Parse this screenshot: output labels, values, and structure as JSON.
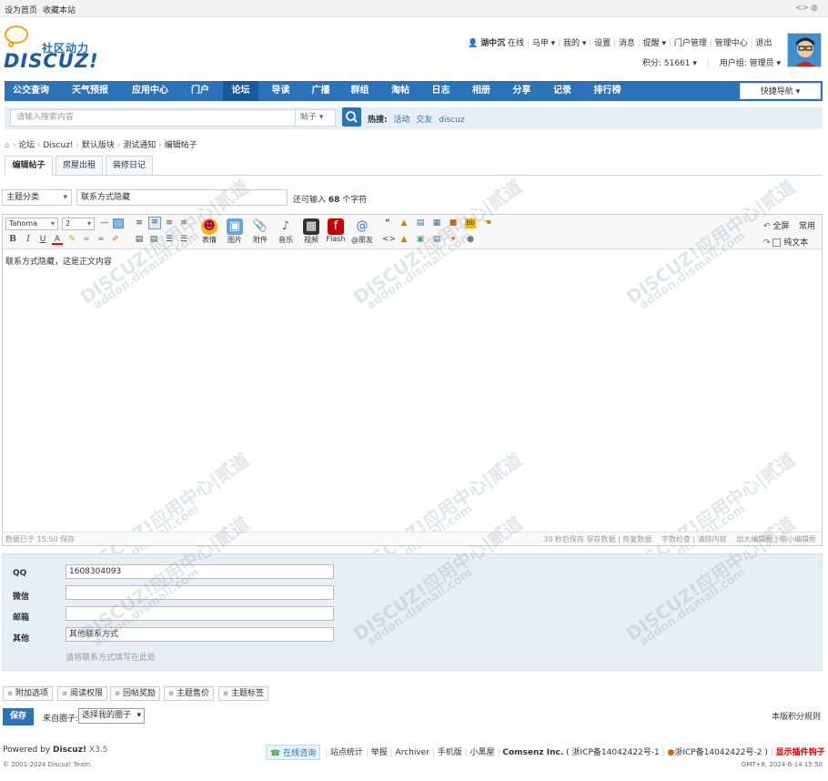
{
  "topbar": {
    "set_home": "设为首页",
    "bookmark": "收藏本站"
  },
  "logo": {
    "sub": "社区动力",
    "text": "DISCUZ!"
  },
  "user": {
    "name": "湖中沉",
    "status": "在线",
    "links": [
      "马甲 ▾",
      "我的 ▾",
      "设置",
      "消息",
      "提醒 ▾",
      "门户管理",
      "管理中心",
      "退出"
    ],
    "points": "积分: 51661 ▾",
    "group": "用户组: 管理员 ▾"
  },
  "nav": {
    "items": [
      "公交查询",
      "天气预报",
      "应用中心",
      "门户",
      "论坛",
      "导读",
      "广播",
      "群组",
      "淘帖",
      "日志",
      "相册",
      "分享",
      "记录",
      "排行榜"
    ],
    "quick": "快捷导航 ▾"
  },
  "search": {
    "placeholder": "请输入搜索内容",
    "type": "帖子 ▾",
    "hot_label": "热搜:",
    "hot": [
      "活动",
      "交友",
      "discuz"
    ]
  },
  "breadcrumb": [
    "论坛",
    "Discuz!",
    "默认版块",
    "测试通知",
    "编辑帖子"
  ],
  "tabs": [
    "编辑帖子",
    "房屋出租",
    "装修日记"
  ],
  "form": {
    "category": "主题分类",
    "title": "联系方式隐藏",
    "remain_prefix": "还可输入",
    "remain_count": "68",
    "remain_suffix": "个字符"
  },
  "editor": {
    "font": "Tahoma",
    "size": "2",
    "big_buttons": [
      "表情",
      "图片",
      "附件",
      "音乐",
      "视频",
      "Flash",
      "@朋友"
    ],
    "fullscreen": "全屏",
    "common": "常用",
    "plaintext": "纯文本",
    "content": "联系方式隐藏，这是正文内容",
    "saved": "数据已于 15:50 保存",
    "footer_right": [
      "30 秒后保存",
      "保存数据",
      "恢复数据",
      "字数检查",
      "清除内容",
      "加大编辑框",
      "缩小编辑框"
    ]
  },
  "contact": {
    "fields": [
      {
        "label": "QQ",
        "value": "1608304093"
      },
      {
        "label": "微信",
        "value": ""
      },
      {
        "label": "邮箱",
        "value": ""
      },
      {
        "label": "其他",
        "value": "其他联系方式"
      }
    ],
    "hint": "请将联系方式填写在此处"
  },
  "options": [
    "附加选项",
    "阅读权限",
    "回帖奖励",
    "主题售价",
    "主题标签"
  ],
  "actions": {
    "save": "保存",
    "from_group_label": "来自圈子:",
    "group_select": "选择我的圈子",
    "rules": "本版积分规则"
  },
  "footer": {
    "powered": "Powered by",
    "brand": "Discuz!",
    "version": "X3.5",
    "copyright": "© 2001-2024 Discuz! Team.",
    "online": "在线咨询",
    "links": [
      "站点统计",
      "举报",
      "Archiver",
      "手机版",
      "小黑屋"
    ],
    "company": "Comsenz Inc.",
    "icp1": "( 浙ICP备14042422号-1",
    "icp2": "浙ICP备14042422号-2 )",
    "hook": "显示插件钩子",
    "time": "GMT+8, 2024-6-14 15:50"
  },
  "watermark": {
    "line1": "DISCUZ!应用中心|贰道",
    "line2": "addon.dismall.com"
  },
  "colors": {
    "accent": "#2b72b8",
    "active_nav": "#195a9c",
    "hook": "#e00000"
  }
}
